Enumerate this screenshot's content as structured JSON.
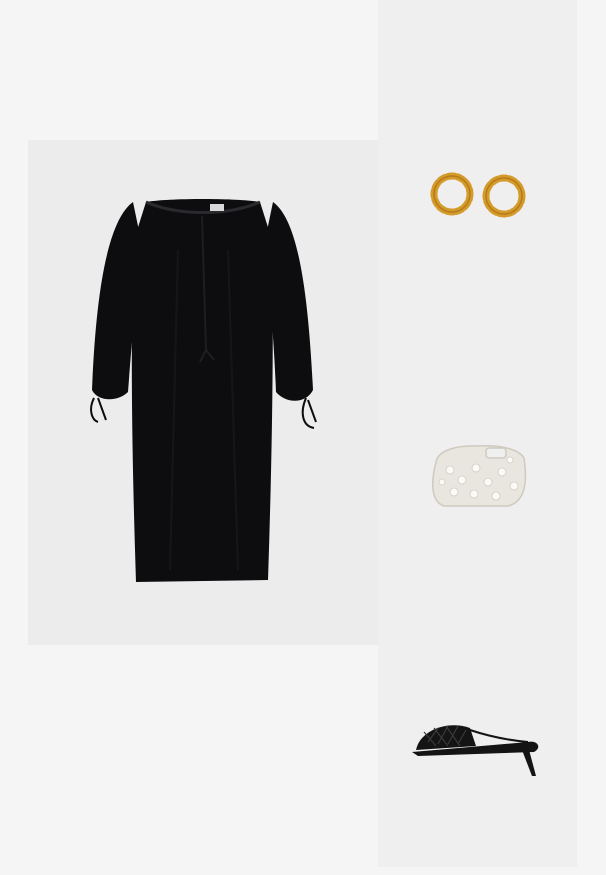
{
  "colors": {
    "page_background": "#f5f5f5",
    "panel_background": "#ececec",
    "right_panel_background": "#efefef",
    "dress": "#0d0d0f",
    "gold": "#d49a2a",
    "clutch": "#e9e6df",
    "sandal": "#141414"
  },
  "products": [
    {
      "id": "dress",
      "icon": "black-dress-icon"
    },
    {
      "id": "earrings",
      "icon": "gold-hoop-earrings-icon"
    },
    {
      "id": "clutch",
      "icon": "white-embellished-clutch-icon"
    },
    {
      "id": "sandal",
      "icon": "black-woven-mule-icon"
    }
  ]
}
